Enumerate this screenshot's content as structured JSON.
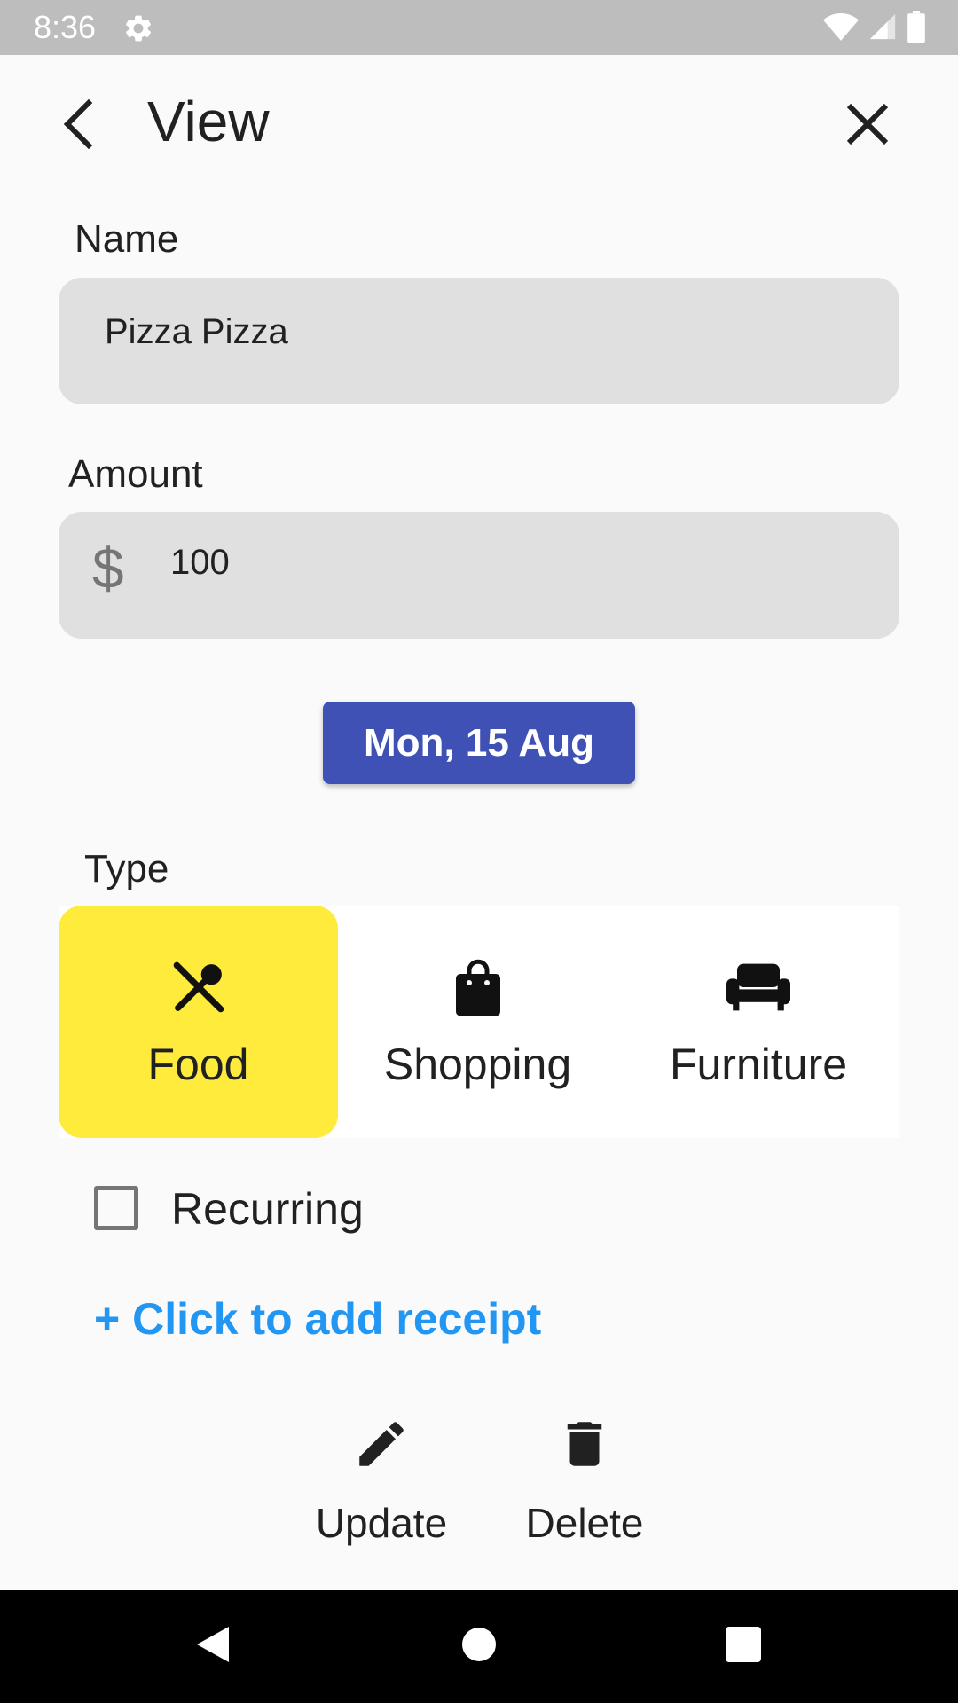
{
  "status_bar": {
    "time": "8:36",
    "icons": [
      "gear-icon",
      "wifi-icon",
      "signal-icon",
      "battery-icon"
    ]
  },
  "app_bar": {
    "title": "View",
    "icons": [
      "back-arrow-icon",
      "close-icon"
    ]
  },
  "form": {
    "name": {
      "label": "Name",
      "value": "Pizza Pizza"
    },
    "amount": {
      "label": "Amount",
      "currency_symbol": "$",
      "value": "100"
    },
    "date_button": "Mon, 15 Aug",
    "type": {
      "label": "Type",
      "selected": "Food",
      "options": [
        {
          "label": "Food",
          "icon": "utensils-icon"
        },
        {
          "label": "Shopping",
          "icon": "shopping-bag-icon"
        },
        {
          "label": "Furniture",
          "icon": "sofa-icon"
        }
      ]
    },
    "recurring": {
      "label": "Recurring",
      "checked": false
    },
    "receipt_link": "+ Click to add receipt"
  },
  "actions": [
    {
      "label": "Update",
      "icon": "pencil-icon"
    },
    {
      "label": "Delete",
      "icon": "trash-icon"
    }
  ],
  "colors": {
    "accent": "#3f51b5",
    "selected_type": "#ffeb3b",
    "link": "#2196f3",
    "input_bg": "#e0e0e0"
  },
  "nav_bar": {
    "icons": [
      "nav-back-icon",
      "nav-home-icon",
      "nav-recents-icon"
    ]
  }
}
